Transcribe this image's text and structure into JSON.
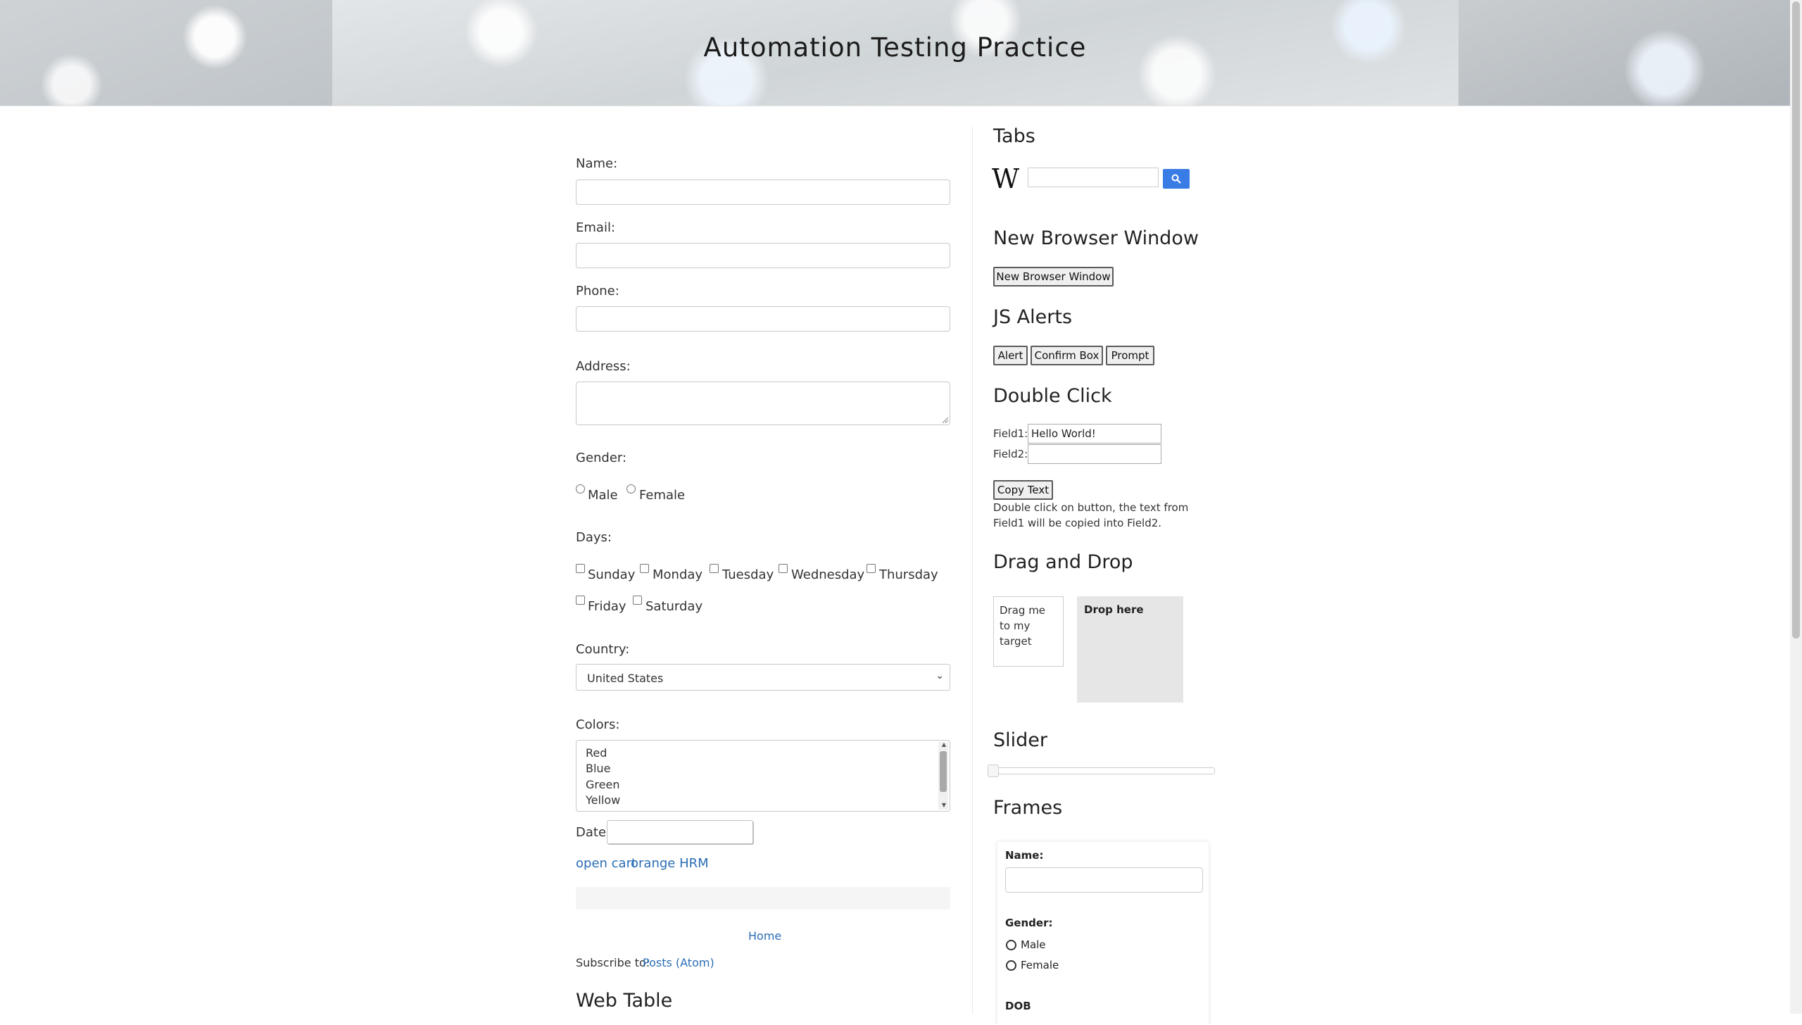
{
  "header": {
    "title": "Automation Testing Practice"
  },
  "form": {
    "name_label": "Name:",
    "email_label": "Email:",
    "phone_label": "Phone:",
    "address_label": "Address:",
    "gender_label": "Gender:",
    "gender_options": [
      "Male",
      "Female"
    ],
    "days_label": "Days:",
    "days": [
      "Sunday",
      "Monday",
      "Tuesday",
      "Wednesday",
      "Thursday",
      "Friday",
      "Saturday"
    ],
    "country_label": "Country:",
    "country_value": "United States",
    "colors_label": "Colors:",
    "colors_options": [
      "Red",
      "Blue",
      "Green",
      "Yellow"
    ],
    "date_label": "Date:"
  },
  "links": {
    "open_cart": "open cart",
    "orange_hrm": "orange HRM"
  },
  "footer": {
    "home": "Home",
    "subscribe_label": "Subscribe to:",
    "subscribe_link": "Posts (Atom)"
  },
  "web_table": {
    "heading": "Web Table"
  },
  "sidebar": {
    "tabs_heading": "Tabs",
    "wiki_logo": "W",
    "new_window_heading": "New Browser Window",
    "new_window_button": "New Browser Window",
    "alerts_heading": "JS Alerts",
    "alert_buttons": [
      "Alert",
      "Confirm Box",
      "Prompt"
    ],
    "double_click_heading": "Double Click",
    "field1_label": "Field1:",
    "field1_value": "Hello World!",
    "field2_label": "Field2:",
    "copy_button": "Copy Text",
    "copy_note": "Double click on button, the text from Field1 will be copied into Field2.",
    "drag_heading": "Drag and Drop",
    "drag_text": "Drag me to my target",
    "drop_text": "Drop here",
    "slider_heading": "Slider",
    "slider_value": 0,
    "frames_heading": "Frames",
    "frame": {
      "name_label": "Name:",
      "gender_label": "Gender:",
      "gender_options": [
        "Male",
        "Female"
      ],
      "dob_label": "DOB"
    }
  }
}
